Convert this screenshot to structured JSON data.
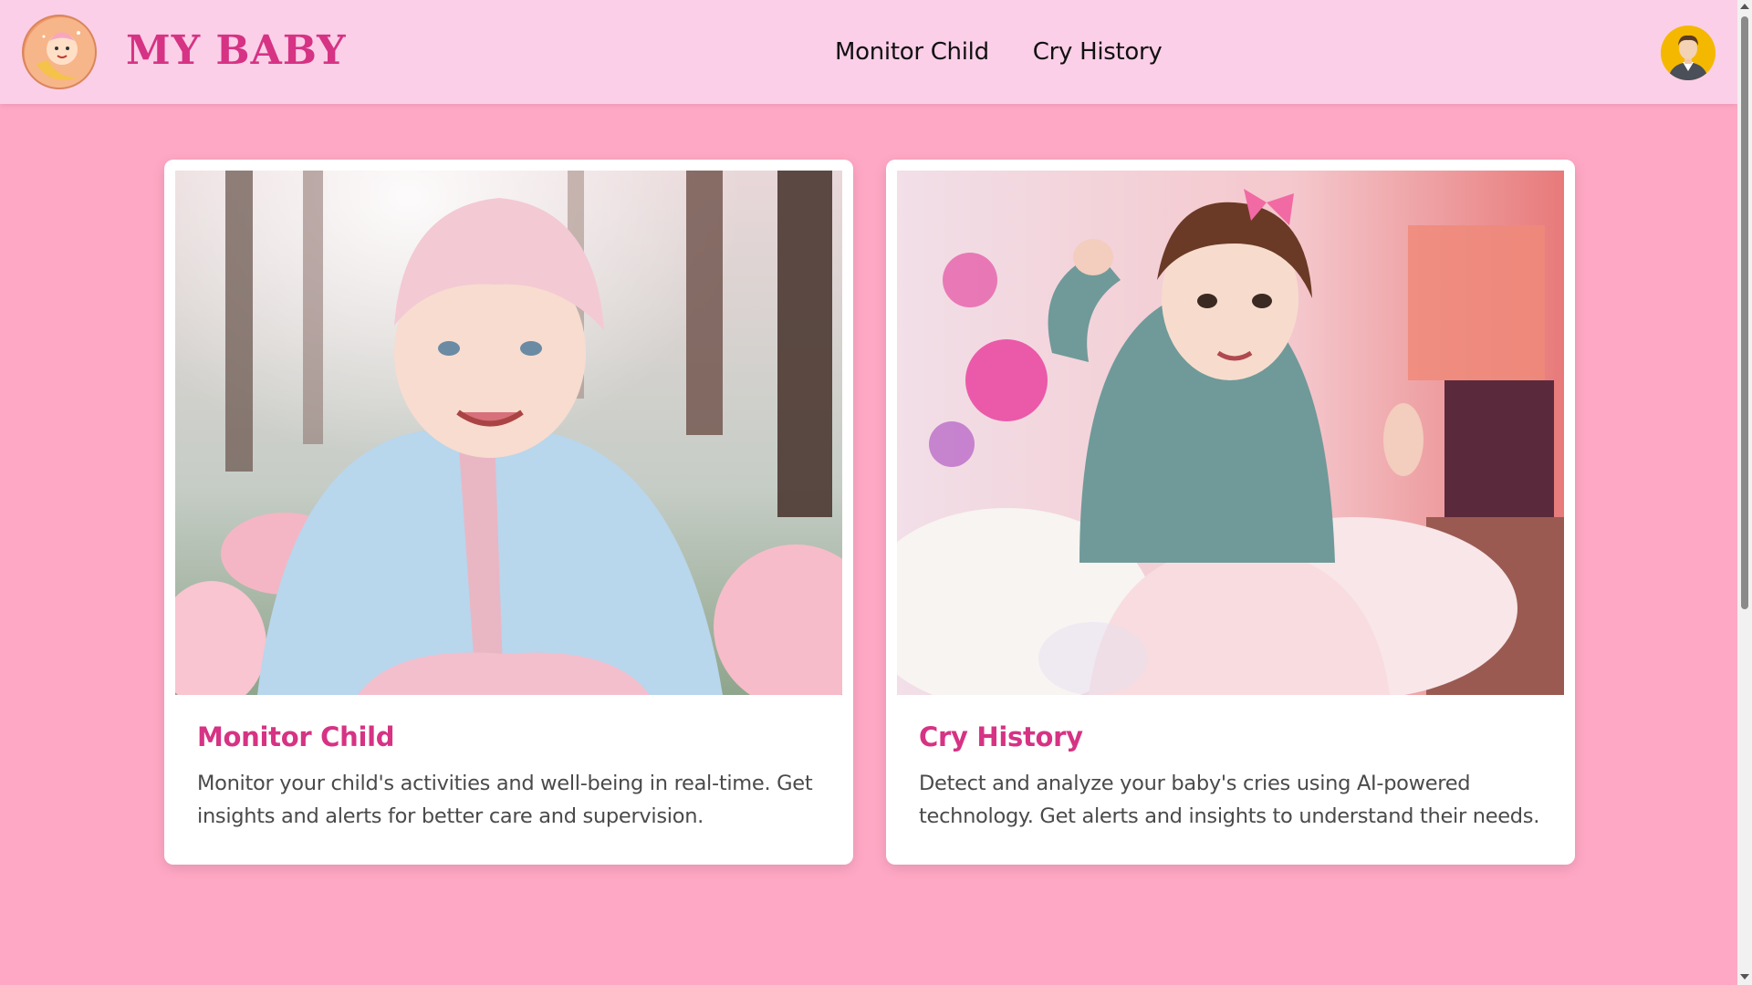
{
  "brand": {
    "name": "MY BABY",
    "logo_icon": "baby-moon-logo-icon"
  },
  "nav": {
    "items": [
      {
        "label": "Monitor Child"
      },
      {
        "label": "Cry History"
      }
    ]
  },
  "user": {
    "avatar_icon": "user-avatar-icon"
  },
  "cards": [
    {
      "title": "Monitor Child",
      "description": "Monitor your child's activities and well-being in real-time. Get insights and alerts for better care and supervision.",
      "image": "baby-in-blue-hoodie-photo"
    },
    {
      "title": "Cry History",
      "description": "Detect and analyze your baby's cries using AI-powered technology. Get alerts and insights to understand their needs.",
      "image": "baby-girl-in-teal-sweater-photo"
    }
  ],
  "colors": {
    "page_bg": "#ffa8c5",
    "header_bg": "#fbcfe8",
    "accent": "#d63384",
    "card_bg": "#ffffff",
    "text_body": "#4a4a4a"
  }
}
